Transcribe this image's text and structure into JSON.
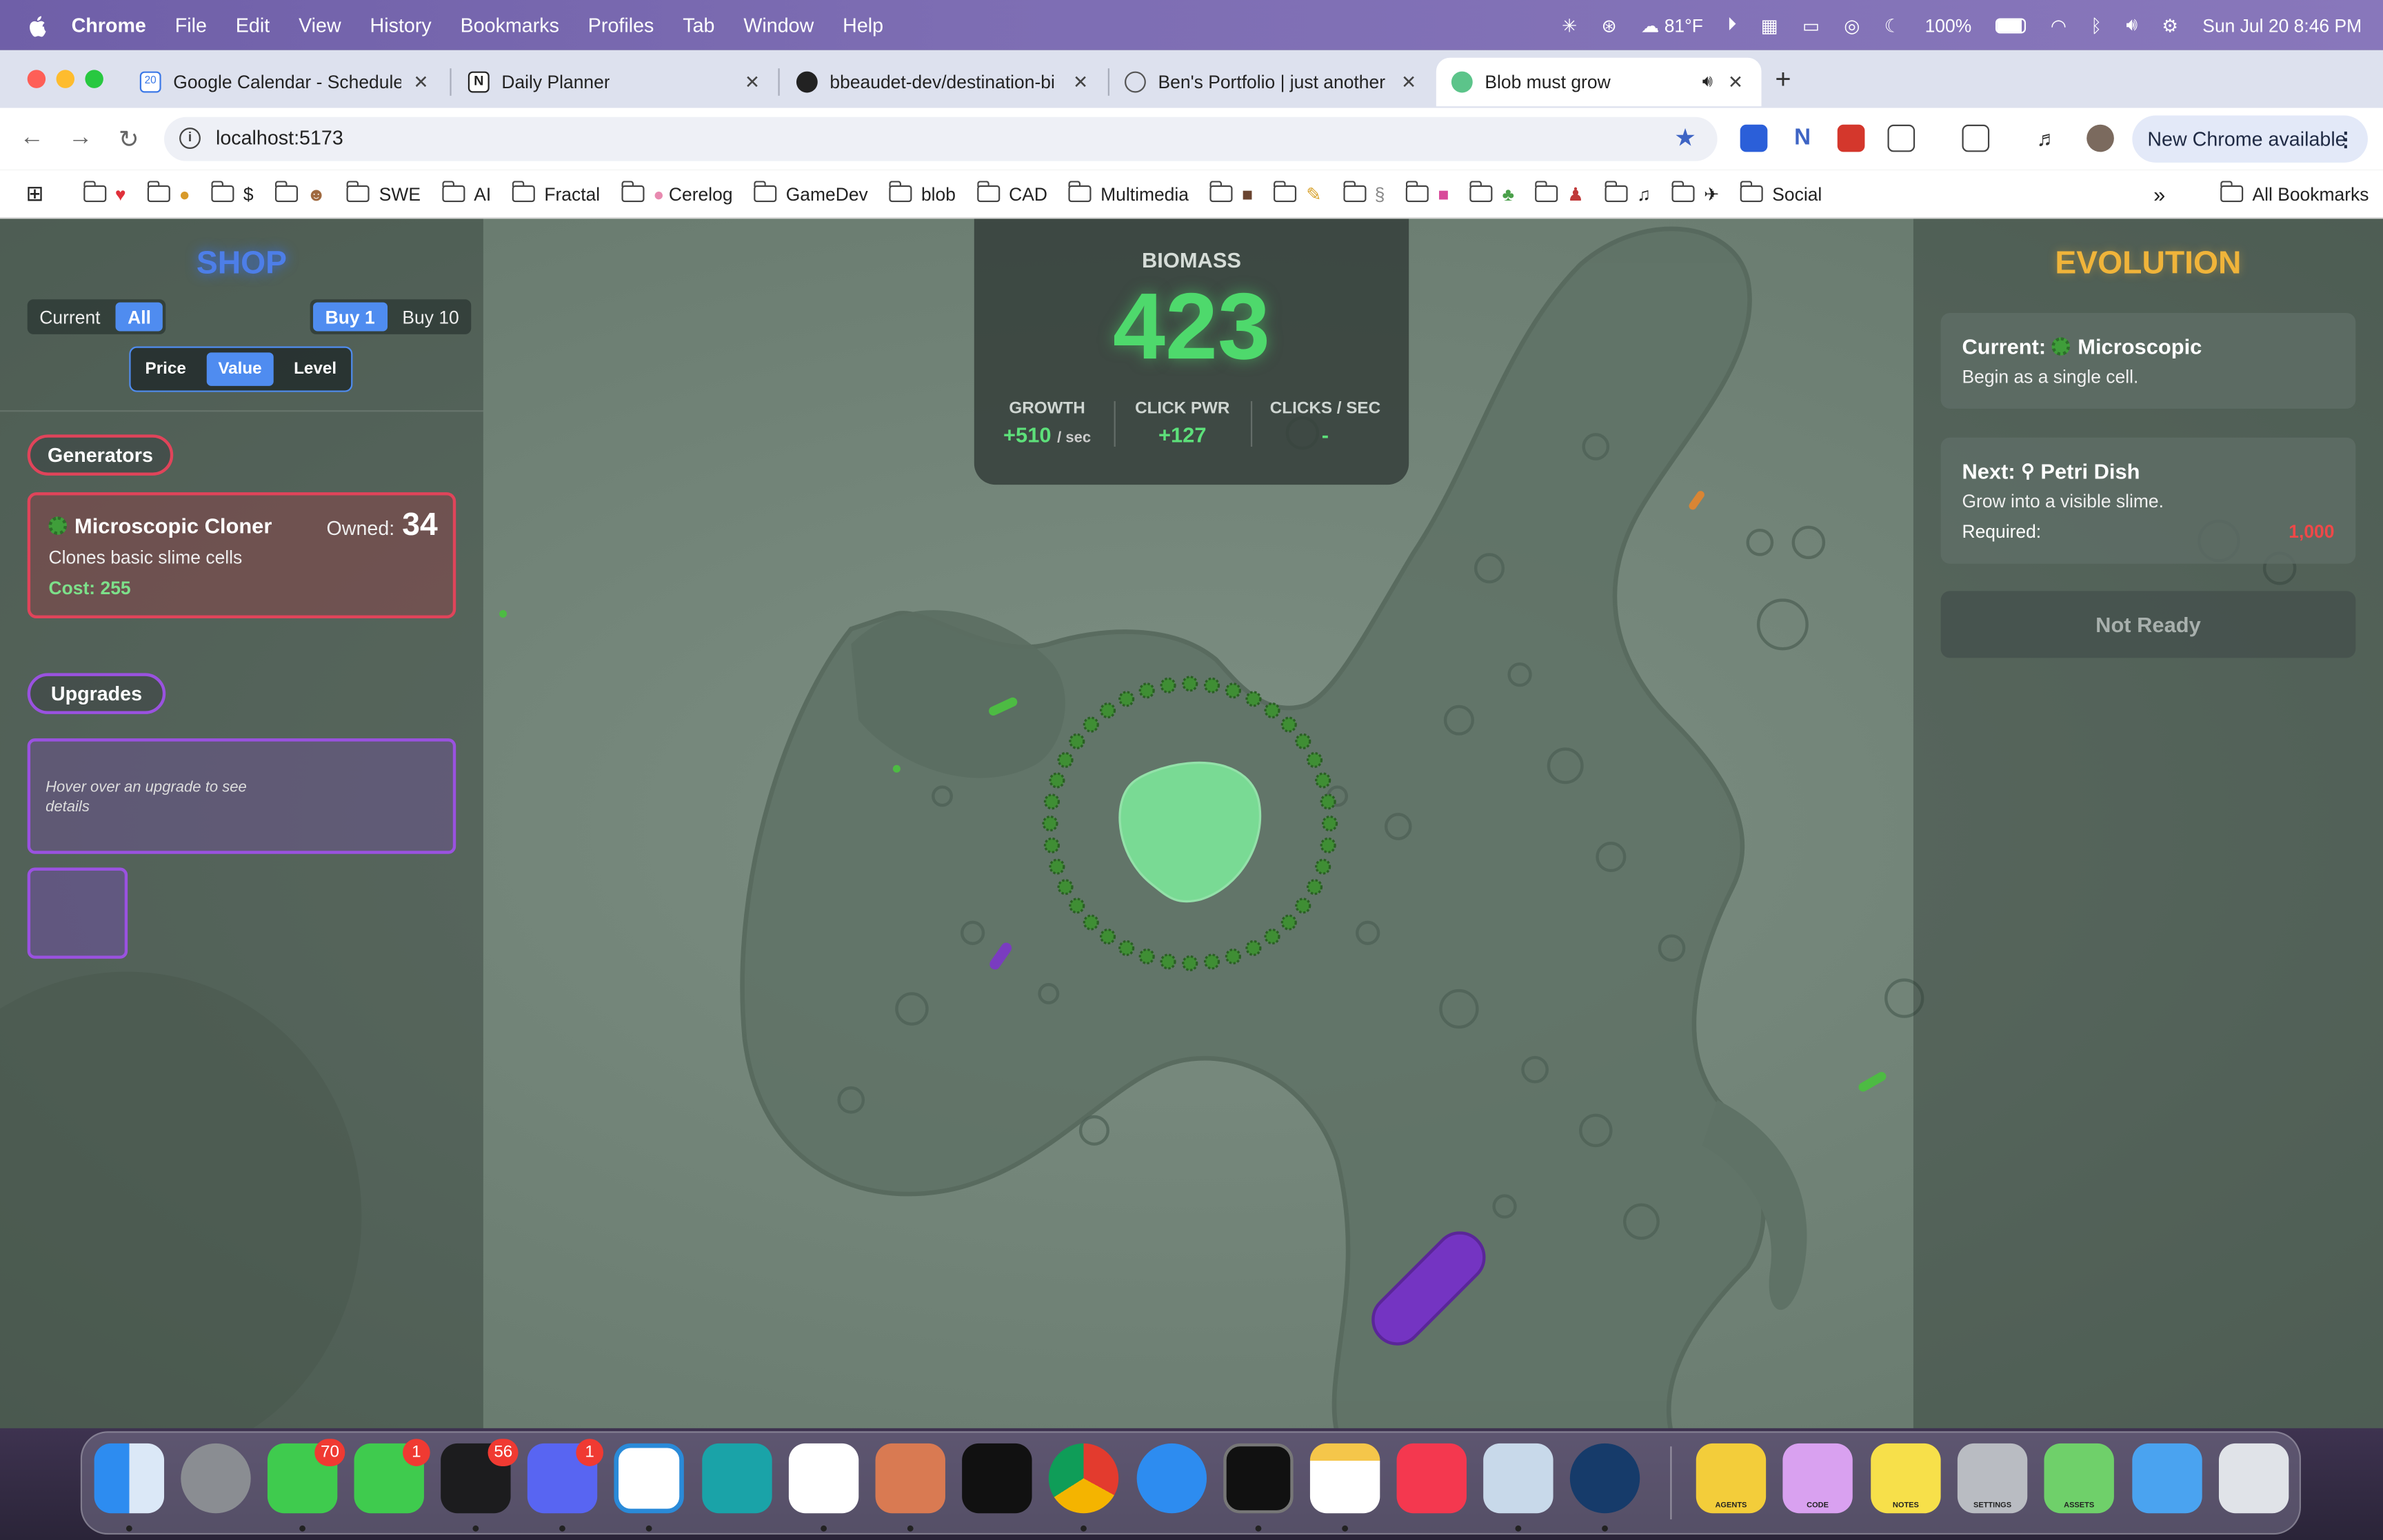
{
  "menubar": {
    "app": "Chrome",
    "items": [
      "File",
      "Edit",
      "View",
      "History",
      "Bookmarks",
      "Profiles",
      "Tab",
      "Window",
      "Help"
    ],
    "weather": "81°F",
    "battery": "100%",
    "datetime": "Sun Jul 20  8:46 PM"
  },
  "tabs": [
    {
      "title": "Google Calendar - Schedule"
    },
    {
      "title": "Daily Planner"
    },
    {
      "title": "bbeaudet-dev/destination-bi"
    },
    {
      "title": "Ben's Portfolio | just another"
    },
    {
      "title": "Blob must grow"
    }
  ],
  "address": {
    "url": "localhost:5173",
    "update_label": "New Chrome available"
  },
  "bookmarks": [
    "$",
    "SWE",
    "AI",
    "Fractal",
    "Cerelog",
    "GameDev",
    "blob",
    "CAD",
    "Multimedia",
    "Social"
  ],
  "bookmarks_all": "All Bookmarks",
  "shop": {
    "title": "SHOP",
    "filter": [
      "Current",
      "All"
    ],
    "buy": [
      "Buy 1",
      "Buy 10"
    ],
    "sort": [
      "Price",
      "Value",
      "Level"
    ],
    "generators_label": "Generators",
    "upgrades_label": "Upgrades",
    "upgrade_hint": "Hover over an upgrade to see details",
    "generator": {
      "name": "Microscopic Cloner",
      "description": "Clones basic slime cells",
      "cost_label": "Cost:",
      "cost": "255",
      "owned_label": "Owned:",
      "owned": "34"
    }
  },
  "hud": {
    "label": "BIOMASS",
    "value": "423",
    "growth_label": "GROWTH",
    "growth_value": "+510",
    "growth_unit": "/ sec",
    "click_label": "CLICK PWR",
    "click_value": "+127",
    "cps_label": "CLICKS / SEC",
    "cps_value": "-"
  },
  "evolution": {
    "title": "EVOLUTION",
    "current_prefix": "Current:",
    "current_name": "Microscopic",
    "current_desc": "Begin as a single cell.",
    "next_prefix": "Next:",
    "next_name": "Petri Dish",
    "next_desc": "Grow into a visible slime.",
    "required_label": "Required:",
    "required_value": "1,000",
    "button": "Not Ready"
  },
  "dock": {
    "badges": {
      "messages": "70",
      "facetime": "1",
      "linear": "56",
      "discord": "1"
    },
    "folder_labels": [
      "AGENTS",
      "CODE",
      "NOTES",
      "SETTINGS",
      "ASSETS"
    ]
  },
  "colors": {
    "shop_accent": "#4f8cf0",
    "biomass_green": "#4ed96c",
    "evolution_gold": "#f0b43a",
    "generator_border": "#e0445a",
    "upgrade_border": "#9a52e0",
    "required_red": "#f04848"
  }
}
